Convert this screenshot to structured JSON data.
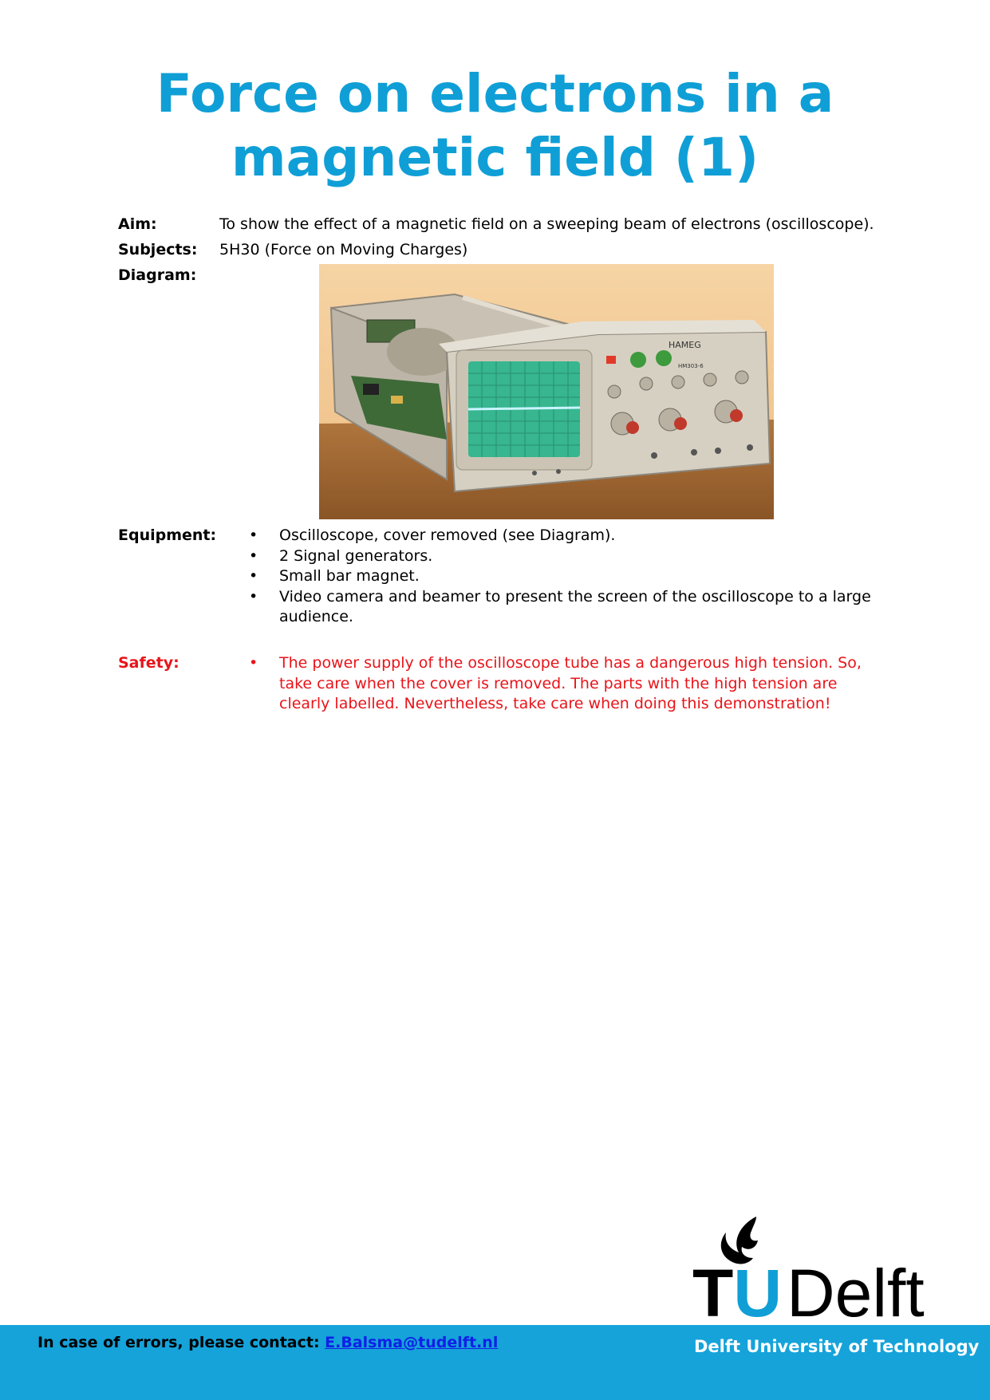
{
  "title_line1": "Force on electrons in a",
  "title_line2": "magnetic field (1)",
  "aim": {
    "label": "Aim:",
    "text": "To show the effect of a magnetic field on a sweeping beam of electrons (oscilloscope)."
  },
  "subjects": {
    "label": "Subjects:",
    "text": "5H30 (Force on Moving Charges)"
  },
  "diagram": {
    "label": "Diagram:"
  },
  "equipment": {
    "label": "Equipment:",
    "items": [
      "Oscilloscope, cover removed (see Diagram).",
      "2 Signal generators.",
      "Small bar magnet.",
      "Video camera and beamer to present the screen of the oscilloscope to a large audience."
    ]
  },
  "safety": {
    "label": "Safety:",
    "items": [
      "The power supply of the oscilloscope tube has a dangerous high tension. So, take care when the cover is removed. The parts with the high tension are clearly labelled. Nevertheless, take care when doing this demonstration!"
    ]
  },
  "footer": {
    "contact_label": "In case of errors, please contact: ",
    "contact_email": "E.Balsma@tudelft.nl",
    "university": "Delft University of Technology"
  },
  "logo": {
    "tu": "TU",
    "delft": "Delft"
  },
  "scope_brand": "HAMEG",
  "scope_model": "HM303-6",
  "colors": {
    "title": "#0f9fd6",
    "safety": "#e8141a",
    "footer": "#15a3da",
    "link": "#1020e6"
  }
}
